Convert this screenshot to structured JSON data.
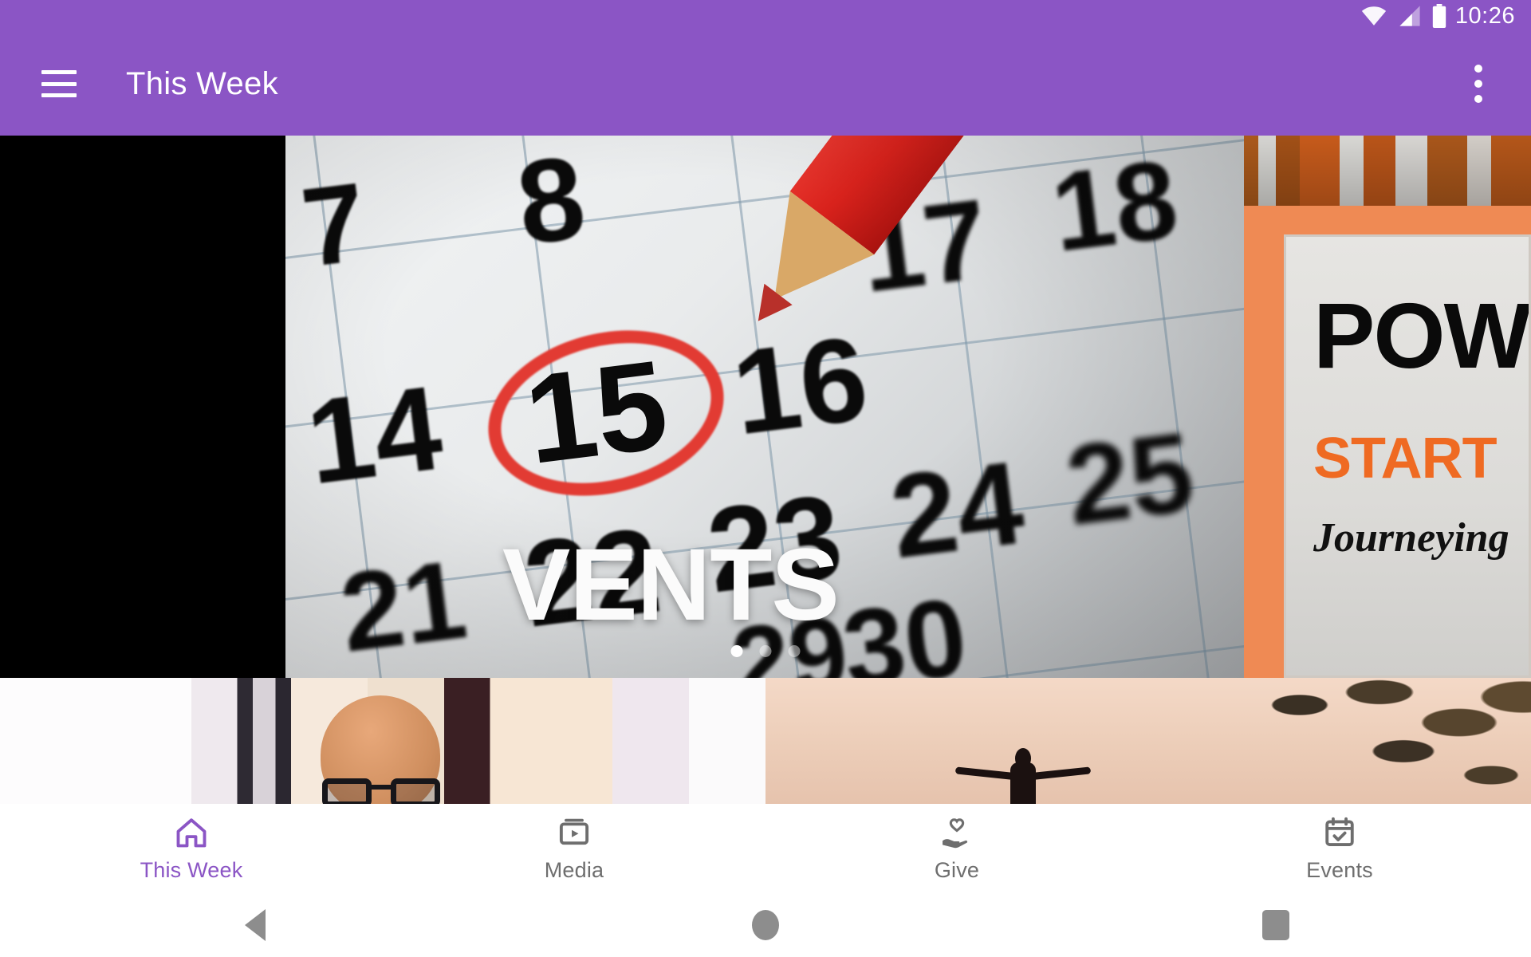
{
  "status_bar": {
    "time": "10:26",
    "icons": [
      "wifi-icon",
      "cellular-signal-icon",
      "battery-icon"
    ]
  },
  "app_bar": {
    "menu_icon": "hamburger-menu-icon",
    "title": "This Week",
    "overflow_icon": "overflow-menu-icon"
  },
  "carousel": {
    "slides": [
      {
        "name": "events-calendar-slide",
        "overlay_text": "VENTS",
        "full_text": "EVENTS",
        "image_description": "close-up of a wall calendar with the date 15 circled in red by a red pencil",
        "calendar_numbers": [
          "7",
          "8",
          "14",
          "15",
          "16",
          "17",
          "18",
          "21",
          "22",
          "23",
          "24",
          "25",
          "29",
          "30"
        ],
        "circled_date": "15"
      },
      {
        "name": "power-starts-slide",
        "heading": "POW",
        "subheading": "START",
        "script_line": "Journeying",
        "full_heading": "POWER",
        "image_description": "orange bordered poster in front of a bookshelf",
        "border_color": "#ef8a54",
        "accent_color": "#ef6a22"
      }
    ],
    "indicator": {
      "count": 3,
      "active_index": 0
    }
  },
  "content_strip": {
    "cards": [
      {
        "name": "sermon-video-card",
        "image_description": "bald man with dark glasses in a room with striped curtains"
      },
      {
        "name": "worship-video-card",
        "image_description": "silhouette of a person with outstretched arms at sunset with pine branches"
      }
    ]
  },
  "bottom_nav": {
    "active_color": "#8B55C5",
    "inactive_color": "#6e6e6e",
    "items": [
      {
        "label": "This Week",
        "icon": "home-icon",
        "active": true
      },
      {
        "label": "Media",
        "icon": "video-library-icon",
        "active": false
      },
      {
        "label": "Give",
        "icon": "hand-holding-heart-icon",
        "active": false
      },
      {
        "label": "Events",
        "icon": "calendar-check-icon",
        "active": false
      }
    ]
  },
  "android_nav": {
    "buttons": [
      {
        "name": "back-button",
        "icon": "triangle-back-icon"
      },
      {
        "name": "home-button",
        "icon": "circle-home-icon"
      },
      {
        "name": "recents-button",
        "icon": "square-recents-icon"
      }
    ]
  },
  "theme": {
    "primary": "#8B55C5",
    "on_primary": "#FFFFFF",
    "surface": "#FFFFFF"
  }
}
